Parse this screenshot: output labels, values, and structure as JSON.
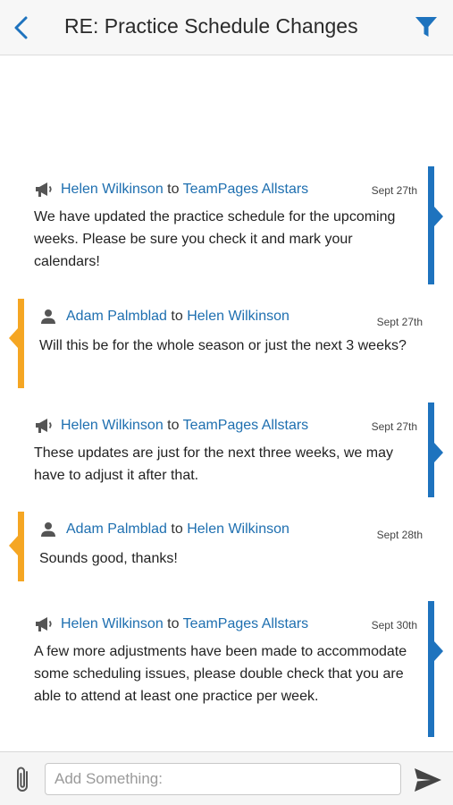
{
  "header": {
    "title": "RE: Practice Schedule Changes",
    "back_icon": "chevron-left-icon",
    "filter_icon": "filter-icon"
  },
  "colors": {
    "accent": "#1e73be",
    "incoming": "#f5a623",
    "link": "#1e6fb0"
  },
  "messages": [
    {
      "direction": "outgoing",
      "icon": "megaphone-icon",
      "from": "Helen Wilkinson",
      "to_word": "to",
      "to": "TeamPages Allstars",
      "date": "Sept 27th",
      "body": "We have updated the practice schedule for the upcoming weeks. Please be sure you check it and mark your calendars!"
    },
    {
      "direction": "incoming",
      "icon": "person-icon",
      "from": "Adam Palmblad",
      "to_word": "to",
      "to": "Helen Wilkinson",
      "date": "Sept 27th",
      "body": "Will this be for the whole season or just the next 3 weeks?"
    },
    {
      "direction": "outgoing",
      "icon": "megaphone-icon",
      "from": "Helen Wilkinson",
      "to_word": "to",
      "to": "TeamPages Allstars",
      "date": "Sept 27th",
      "body": "These updates are just for the next three weeks, we may have to adjust it after that."
    },
    {
      "direction": "incoming",
      "icon": "person-icon",
      "from": "Adam Palmblad",
      "to_word": "to",
      "to": "Helen Wilkinson",
      "date": "Sept 28th",
      "body": "Sounds good, thanks!"
    },
    {
      "direction": "outgoing",
      "icon": "megaphone-icon",
      "from": "Helen Wilkinson",
      "to_word": "to",
      "to": "TeamPages Allstars",
      "date": "Sept 30th",
      "body": "A few more adjustments have been made to accommodate some scheduling issues, please double check that you are able to attend at least one practice per week."
    }
  ],
  "composer": {
    "placeholder": "Add Something:",
    "value": "",
    "attach_icon": "paperclip-icon",
    "send_icon": "send-icon"
  }
}
